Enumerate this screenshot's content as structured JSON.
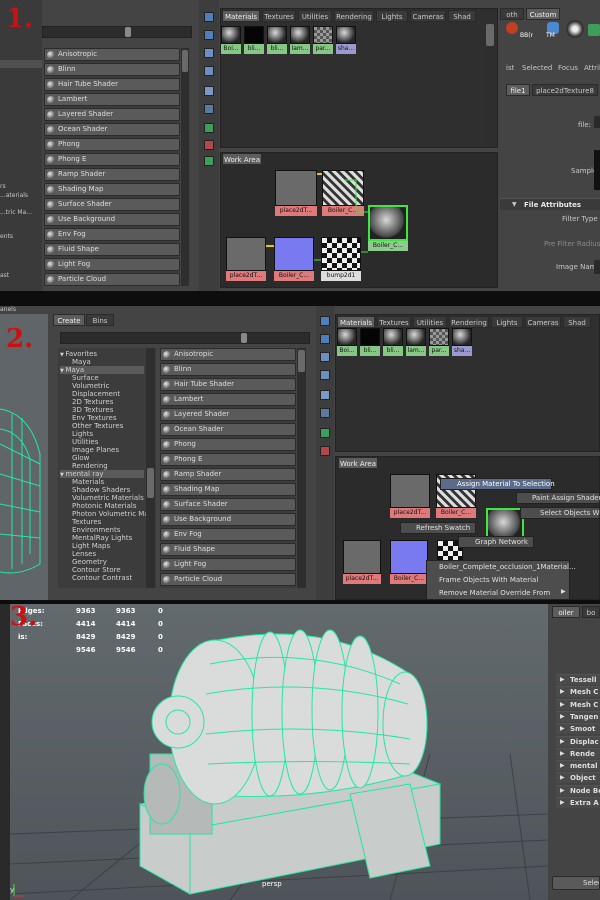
{
  "steps": [
    "1.",
    "2.",
    "3."
  ],
  "tabs": [
    "Materials",
    "Textures",
    "Utilities",
    "Rendering",
    "Lights",
    "Cameras",
    "Shad"
  ],
  "shaders": [
    "Anisotropic",
    "Blinn",
    "Hair Tube Shader",
    "Lambert",
    "Layered Shader",
    "Ocean Shader",
    "Phong",
    "Phong E",
    "Ramp Shader",
    "Shading Map",
    "Surface Shader",
    "Use Background",
    "Env Fog",
    "Fluid Shape",
    "Light Fog",
    "Particle Cloud"
  ],
  "swatches": [
    "Boi...",
    "bli...",
    "bli...",
    "lam...",
    "par...",
    "sha..."
  ],
  "work_area": "Work Area",
  "nodes": {
    "place2d": "place2dT...",
    "boiler": "Boiler_C...",
    "bump": "bump2d1"
  },
  "panel1_left": [
    "rs",
    "...aterials",
    "...tric Ma...",
    "ents",
    "ast"
  ],
  "attr_editor": {
    "tabs": [
      "oth",
      "Custom"
    ],
    "shelf": [
      "BB(r",
      "TM"
    ],
    "menu": [
      "ist",
      "Selected",
      "Focus",
      "Attrib"
    ],
    "node_tabs": [
      "file1",
      "place2dTexture8"
    ],
    "file_label": "file:",
    "sample_label": "Sample",
    "section": "File Attributes",
    "filter_type": "Filter Type",
    "pre_filter_radius": "Pre Filter Radius",
    "image_name": "Image Name"
  },
  "hypershade2": {
    "top_label": "anels",
    "create_tabs": [
      "Create",
      "Bins"
    ],
    "tree": [
      {
        "label": "Favorites",
        "level": 0,
        "selected": false
      },
      {
        "label": "Maya",
        "level": 1,
        "selected": false
      },
      {
        "label": "Maya",
        "level": 0,
        "selected": true
      },
      {
        "label": "Surface",
        "level": 1,
        "selected": false
      },
      {
        "label": "Volumetric",
        "level": 1,
        "selected": false
      },
      {
        "label": "Displacement",
        "level": 1,
        "selected": false
      },
      {
        "label": "2D Textures",
        "level": 1,
        "selected": false
      },
      {
        "label": "3D Textures",
        "level": 1,
        "selected": false
      },
      {
        "label": "Env Textures",
        "level": 1,
        "selected": false
      },
      {
        "label": "Other Textures",
        "level": 1,
        "selected": false
      },
      {
        "label": "Lights",
        "level": 1,
        "selected": false
      },
      {
        "label": "Utilities",
        "level": 1,
        "selected": false
      },
      {
        "label": "Image Planes",
        "level": 1,
        "selected": false
      },
      {
        "label": "Glow",
        "level": 1,
        "selected": false
      },
      {
        "label": "Rendering",
        "level": 1,
        "selected": false
      },
      {
        "label": "mental ray",
        "level": 0,
        "selected": true
      },
      {
        "label": "Materials",
        "level": 1,
        "selected": false
      },
      {
        "label": "Shadow Shaders",
        "level": 1,
        "selected": false
      },
      {
        "label": "Volumetric Materials",
        "level": 1,
        "selected": false
      },
      {
        "label": "Photonic Materials",
        "level": 1,
        "selected": false
      },
      {
        "label": "Photon Volumetric Ma...",
        "level": 1,
        "selected": false
      },
      {
        "label": "Textures",
        "level": 1,
        "selected": false
      },
      {
        "label": "Environments",
        "level": 1,
        "selected": false
      },
      {
        "label": "MentalRay Lights",
        "level": 1,
        "selected": false
      },
      {
        "label": "Light Maps",
        "level": 1,
        "selected": false
      },
      {
        "label": "Lenses",
        "level": 1,
        "selected": false
      },
      {
        "label": "Geometry",
        "level": 1,
        "selected": false
      },
      {
        "label": "Contour Store",
        "level": 1,
        "selected": false
      },
      {
        "label": "Contour Contrast",
        "level": 1,
        "selected": false
      }
    ],
    "context_menu": {
      "assign": "Assign Material To Selection",
      "paint": "Paint Assign Shader",
      "select_objects": "Select Objects With",
      "refresh": "Refresh Swatch",
      "graph": "Graph Network",
      "occlusion": "Boiler_Complete_occlusion_1Material...",
      "frame": "Frame Objects With Material",
      "remove_override": "Remove Material Override From"
    }
  },
  "viewport": {
    "stats": [
      {
        "label": "Edges:",
        "a": "9363",
        "b": "9363",
        "c": "0"
      },
      {
        "label": "Faces:",
        "a": "4414",
        "b": "4414",
        "c": "0"
      },
      {
        "label": "is:",
        "a": "8429",
        "b": "8429",
        "c": "0"
      },
      {
        "label": "",
        "a": "9546",
        "b": "9546",
        "c": "0"
      }
    ],
    "persp": "persp",
    "tab_left": "oiler",
    "tab_right": "bo",
    "attributes": [
      "Tessell",
      "Mesh C",
      "Mesh C",
      "Tangen",
      "Smoot",
      "Displac",
      "Rende",
      "mental",
      "Object",
      "Node Be",
      "Extra A"
    ],
    "select_button": "Selec"
  },
  "colors": {
    "wire": "#23e8a4",
    "step": "#cc1010",
    "swatch_label": "#86c786",
    "node_label": "#e07a7a"
  }
}
